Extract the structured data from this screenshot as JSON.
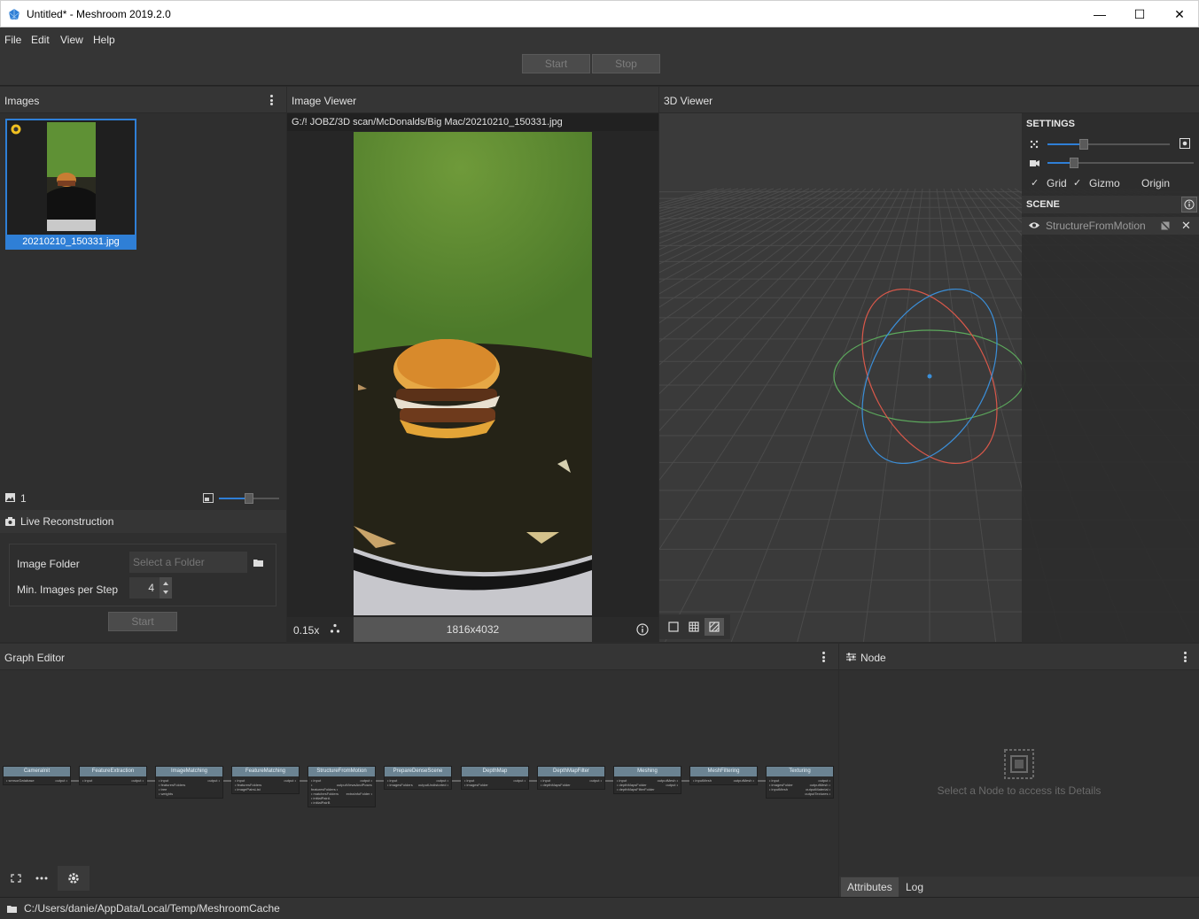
{
  "window": {
    "title": "Untitled* - Meshroom 2019.2.0",
    "minimize": "—",
    "maximize": "☐",
    "close": "✕"
  },
  "menu": [
    "File",
    "Edit",
    "View",
    "Help"
  ],
  "toolbar": {
    "start": "Start",
    "stop": "Stop"
  },
  "images_panel": {
    "title": "Images",
    "thumb_caption": "20210210_150331.jpg",
    "count": "1",
    "live_title": "Live Reconstruction",
    "image_folder_label": "Image Folder",
    "image_folder_placeholder": "Select a Folder",
    "min_images_label": "Min. Images per Step",
    "min_images_value": "4",
    "start": "Start",
    "thumb_size_fraction": 0.5
  },
  "image_viewer": {
    "title": "Image Viewer",
    "path": "G:/! JOBZ/3D scan/McDonalds/Big Mac/20210210_150331.jpg",
    "zoom": "0.15x",
    "resolution": "1816x4032"
  },
  "viewer3d": {
    "title": "3D Viewer",
    "settings_title": "SETTINGS",
    "slider1": 0.3,
    "slider2": 0.18,
    "grid": "Grid",
    "gizmo": "Gizmo",
    "origin": "Origin",
    "grid_checked": true,
    "gizmo_checked": true,
    "origin_checked": false,
    "scene_title": "SCENE",
    "scene_item": "StructureFromMotion"
  },
  "graph_editor": {
    "title": "Graph Editor",
    "nodes": [
      {
        "name": "CameraInit",
        "in": [
          "sensorDatabase"
        ],
        "out": [
          "output"
        ]
      },
      {
        "name": "FeatureExtraction",
        "in": [
          "input"
        ],
        "out": [
          "output"
        ]
      },
      {
        "name": "ImageMatching",
        "in": [
          "input",
          "featuresFolders",
          "tree",
          "weights"
        ],
        "out": [
          "output"
        ]
      },
      {
        "name": "FeatureMatching",
        "in": [
          "input",
          "featuresFolders",
          "imagePairsList"
        ],
        "out": [
          "output"
        ]
      },
      {
        "name": "StructureFromMotion",
        "in": [
          "input",
          "featuresFolders",
          "matchesFolders",
          "initialPairA",
          "initialPairB"
        ],
        "out": [
          "output",
          "outputViewsAndPoses",
          "extraInfoFolder"
        ]
      },
      {
        "name": "PrepareDenseScene",
        "in": [
          "input",
          "imagesFolders"
        ],
        "out": [
          "output",
          "outputUndistorted"
        ]
      },
      {
        "name": "DepthMap",
        "in": [
          "input",
          "imagesFolder"
        ],
        "out": [
          "output"
        ]
      },
      {
        "name": "DepthMapFilter",
        "in": [
          "input",
          "depthMapsFolder"
        ],
        "out": [
          "output"
        ]
      },
      {
        "name": "Meshing",
        "in": [
          "input",
          "depthMapsFolder",
          "depthMapsFilterFolder"
        ],
        "out": [
          "outputMesh",
          "output"
        ]
      },
      {
        "name": "MeshFiltering",
        "in": [
          "inputMesh"
        ],
        "out": [
          "outputMesh"
        ]
      },
      {
        "name": "Texturing",
        "in": [
          "input",
          "imagesFolder",
          "inputMesh"
        ],
        "out": [
          "output",
          "outputMesh",
          "outputMaterial",
          "outputTextures"
        ]
      }
    ]
  },
  "node_panel": {
    "title": "Node",
    "empty_msg": "Select a Node to access its Details",
    "tab_attributes": "Attributes",
    "tab_log": "Log"
  },
  "status": {
    "path": "C:/Users/danie/AppData/Local/Temp/MeshroomCache"
  },
  "colors": {
    "accent": "#2f7fd6",
    "panel": "#353535",
    "node_header": "#6b8392"
  }
}
